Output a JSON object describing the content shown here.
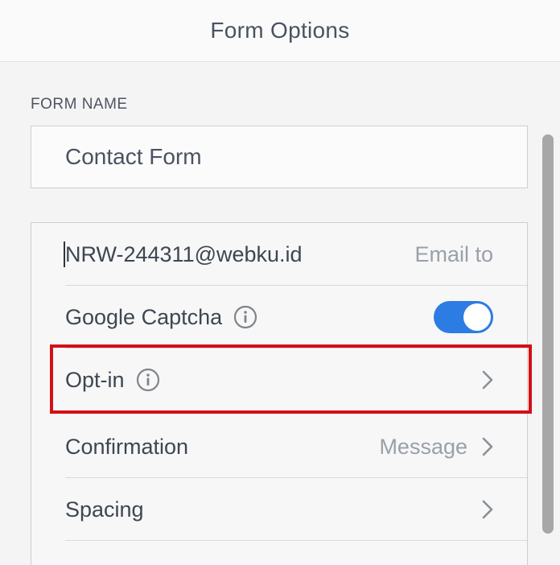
{
  "header": {
    "title": "Form Options"
  },
  "form_name": {
    "label": "FORM NAME",
    "value": "Contact Form"
  },
  "options": {
    "email": {
      "value": "NRW-244311@webku.id",
      "label": "Email to"
    },
    "captcha": {
      "label": "Google Captcha",
      "enabled": true,
      "info_icon": "info-icon"
    },
    "optin": {
      "label": "Opt-in",
      "info_icon": "info-icon",
      "chevron_icon": "chevron-right-icon"
    },
    "confirmation": {
      "label": "Confirmation",
      "value": "Message",
      "chevron_icon": "chevron-right-icon"
    },
    "spacing": {
      "label": "Spacing",
      "chevron_icon": "chevron-right-icon"
    }
  },
  "colors": {
    "toggle_on": "#2d7ce3",
    "highlight": "#d40f16"
  }
}
